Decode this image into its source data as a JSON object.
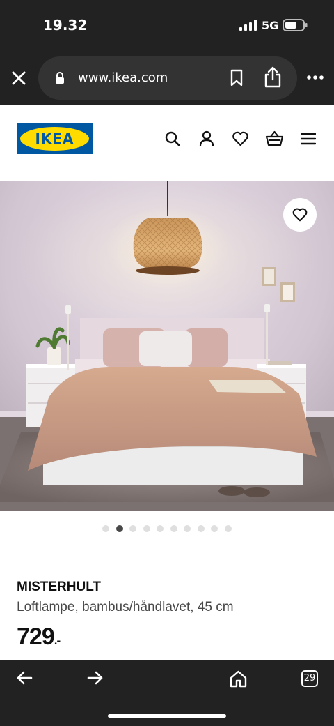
{
  "status_bar": {
    "time": "19.32",
    "network": "5G"
  },
  "browser": {
    "url": "www.ikea.com",
    "tab_count": "29"
  },
  "site": {
    "logo_text": "IKEA"
  },
  "carousel": {
    "total_slides": 10,
    "active_index": 1
  },
  "product": {
    "name": "MISTERHULT",
    "description": "Loftlampe, bambus/håndlavet, ",
    "size": "45 cm",
    "price": "729",
    "price_suffix": ".-"
  },
  "colors": {
    "chrome_bg": "#222222",
    "url_pill_bg": "#333333",
    "ikea_blue": "#0058a3",
    "ikea_yellow": "#ffdb00",
    "dot_active": "#484848",
    "dot_inactive": "#dfdfdf"
  },
  "icons": [
    "close-icon",
    "lock-icon",
    "bookmark-icon",
    "share-icon",
    "more-icon",
    "search-icon",
    "user-icon",
    "heart-icon",
    "basket-icon",
    "menu-icon",
    "back-icon",
    "forward-icon",
    "home-icon",
    "tabs-icon"
  ]
}
